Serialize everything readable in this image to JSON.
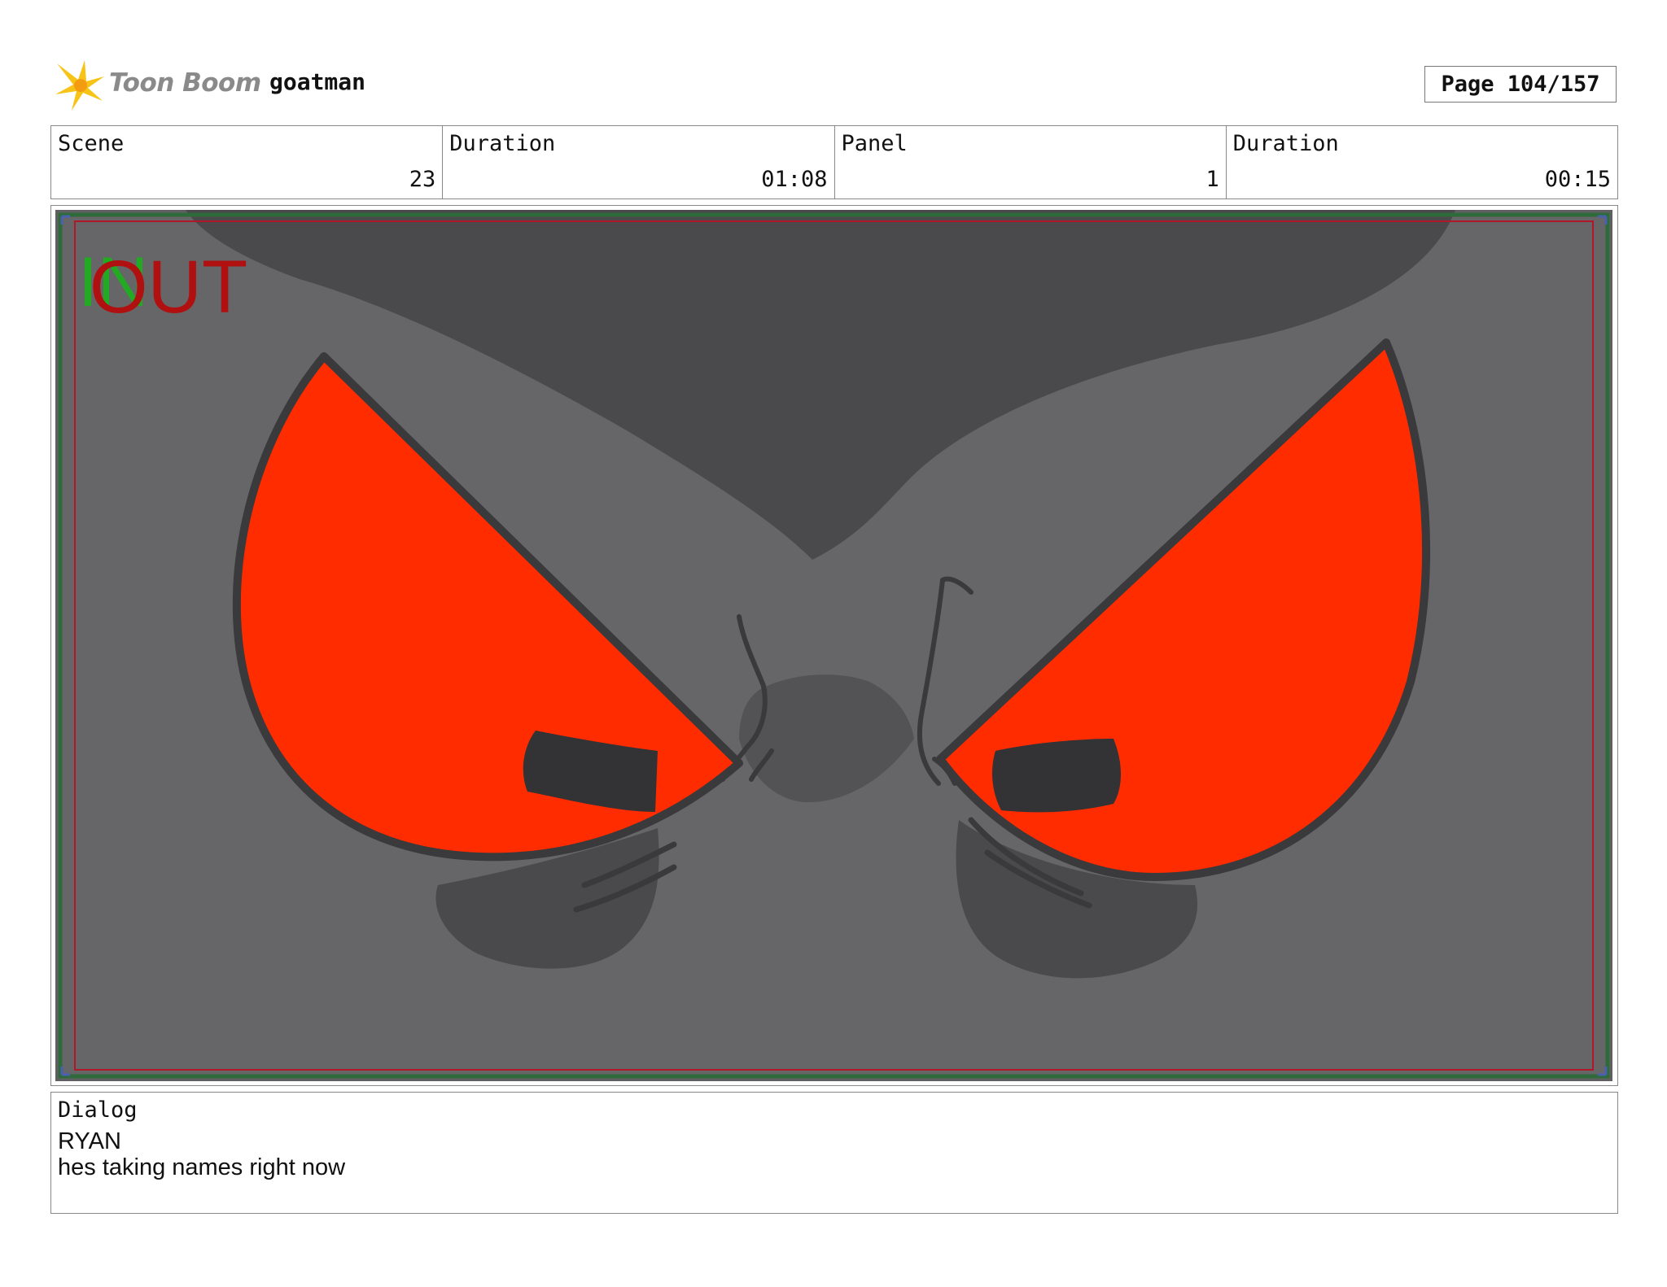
{
  "header": {
    "logo_text": "Toon Boom",
    "project_name": "goatman",
    "page_label": "Page 104/157"
  },
  "info": {
    "scene_label": "Scene",
    "scene_value": "23",
    "scene_duration_label": "Duration",
    "scene_duration_value": "01:08",
    "panel_label": "Panel",
    "panel_value": "1",
    "panel_duration_label": "Duration",
    "panel_duration_value": "00:15"
  },
  "frame": {
    "in_marker": "IN",
    "out_marker": "OUT",
    "in_color": "#22aa22",
    "out_color": "#b01010"
  },
  "dialog": {
    "label": "Dialog",
    "character": "RYAN",
    "line": "hes taking names right now"
  }
}
